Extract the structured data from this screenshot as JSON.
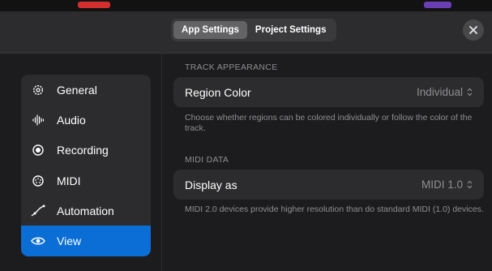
{
  "header": {
    "tabs": [
      {
        "label": "App Settings",
        "active": true
      },
      {
        "label": "Project Settings",
        "active": false
      }
    ],
    "close_icon": "xmark-circle-icon"
  },
  "sidebar": {
    "items": [
      {
        "label": "General",
        "icon": "gear-icon",
        "active": false
      },
      {
        "label": "Audio",
        "icon": "waveform-icon",
        "active": false
      },
      {
        "label": "Recording",
        "icon": "record-icon",
        "active": false
      },
      {
        "label": "MIDI",
        "icon": "midi-port-icon",
        "active": false
      },
      {
        "label": "Automation",
        "icon": "automation-curve-icon",
        "active": false
      },
      {
        "label": "View",
        "icon": "eye-icon",
        "active": true
      }
    ]
  },
  "track_appearance": {
    "header": "TRACK APPEARANCE",
    "region_color_label": "Region Color",
    "region_color_value": "Individual",
    "footer": "Choose whether regions can be colored individually or follow the color of the track."
  },
  "midi_data": {
    "header": "MIDI DATA",
    "display_as_label": "Display as",
    "display_as_value": "MIDI 1.0",
    "footer": "MIDI 2.0 devices provide higher resolution than do standard MIDI (1.0) devices."
  },
  "colors": {
    "accent": "#0a6ed6",
    "background": "#1c1c1e",
    "panel": "#2c2c2e",
    "secondary_text": "#8e8e93"
  }
}
